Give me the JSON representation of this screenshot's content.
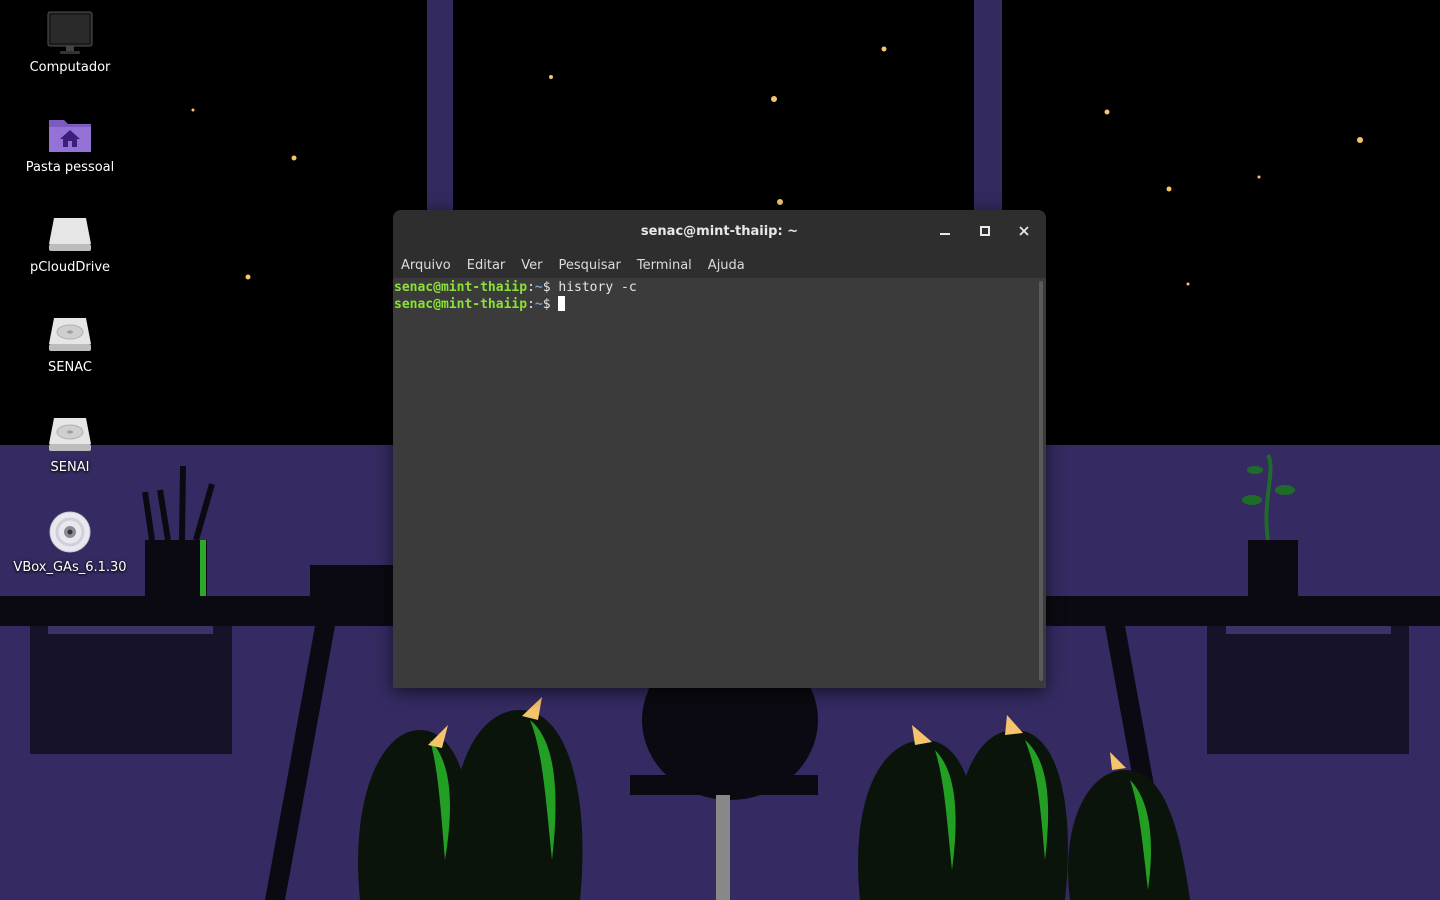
{
  "desktop": {
    "icons": [
      {
        "label": "Computador",
        "icon": "monitor-icon"
      },
      {
        "label": "Pasta pessoal",
        "icon": "home-folder-icon"
      },
      {
        "label": "pCloudDrive",
        "icon": "drive-icon"
      },
      {
        "label": "SENAC",
        "icon": "hard-disk-icon"
      },
      {
        "label": "SENAI",
        "icon": "hard-disk-icon"
      },
      {
        "label": "VBox_GAs_6.1.30",
        "icon": "optical-disc-icon"
      }
    ]
  },
  "terminal": {
    "title": "senac@mint-thaiip: ~",
    "window_buttons": [
      "minimize-icon",
      "maximize-icon",
      "close-icon"
    ],
    "menu": [
      "Arquivo",
      "Editar",
      "Ver",
      "Pesquisar",
      "Terminal",
      "Ajuda"
    ],
    "lines": [
      {
        "user": "senac@mint-thaiip",
        "path": "~",
        "symbol": "$",
        "command": "history -c"
      },
      {
        "user": "senac@mint-thaiip",
        "path": "~",
        "symbol": "$",
        "command": ""
      }
    ]
  },
  "colors": {
    "prompt_user": "#8ae234",
    "prompt_path": "#729fcf",
    "terminal_bg": "#3b3b3b",
    "titlebar_bg": "#2e2e2e"
  }
}
